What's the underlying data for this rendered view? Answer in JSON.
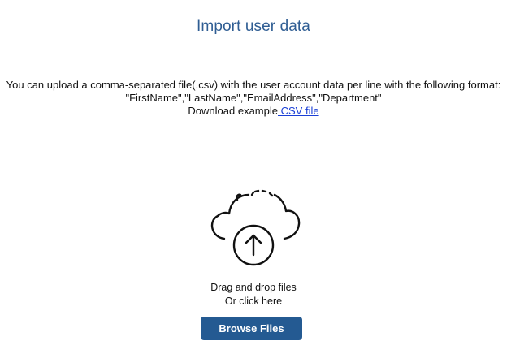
{
  "colors": {
    "title": "#2f5d93",
    "button_bg": "#245a92",
    "button_text": "#ffffff",
    "link": "#1a3fd6"
  },
  "header": {
    "title": "Import user data"
  },
  "instructions": {
    "line1": "You can upload a comma-separated file(.csv) with the user account data per line with the following format:",
    "format": "\"FirstName\",\"LastName\",\"EmailAddress\",\"Department\"",
    "download_prefix": "Download example",
    "download_link": " CSV file"
  },
  "dropzone": {
    "icon": "cloud-upload-icon",
    "line1": "Drag and drop files",
    "line2": "Or click here"
  },
  "actions": {
    "browse_label": "Browse Files"
  }
}
